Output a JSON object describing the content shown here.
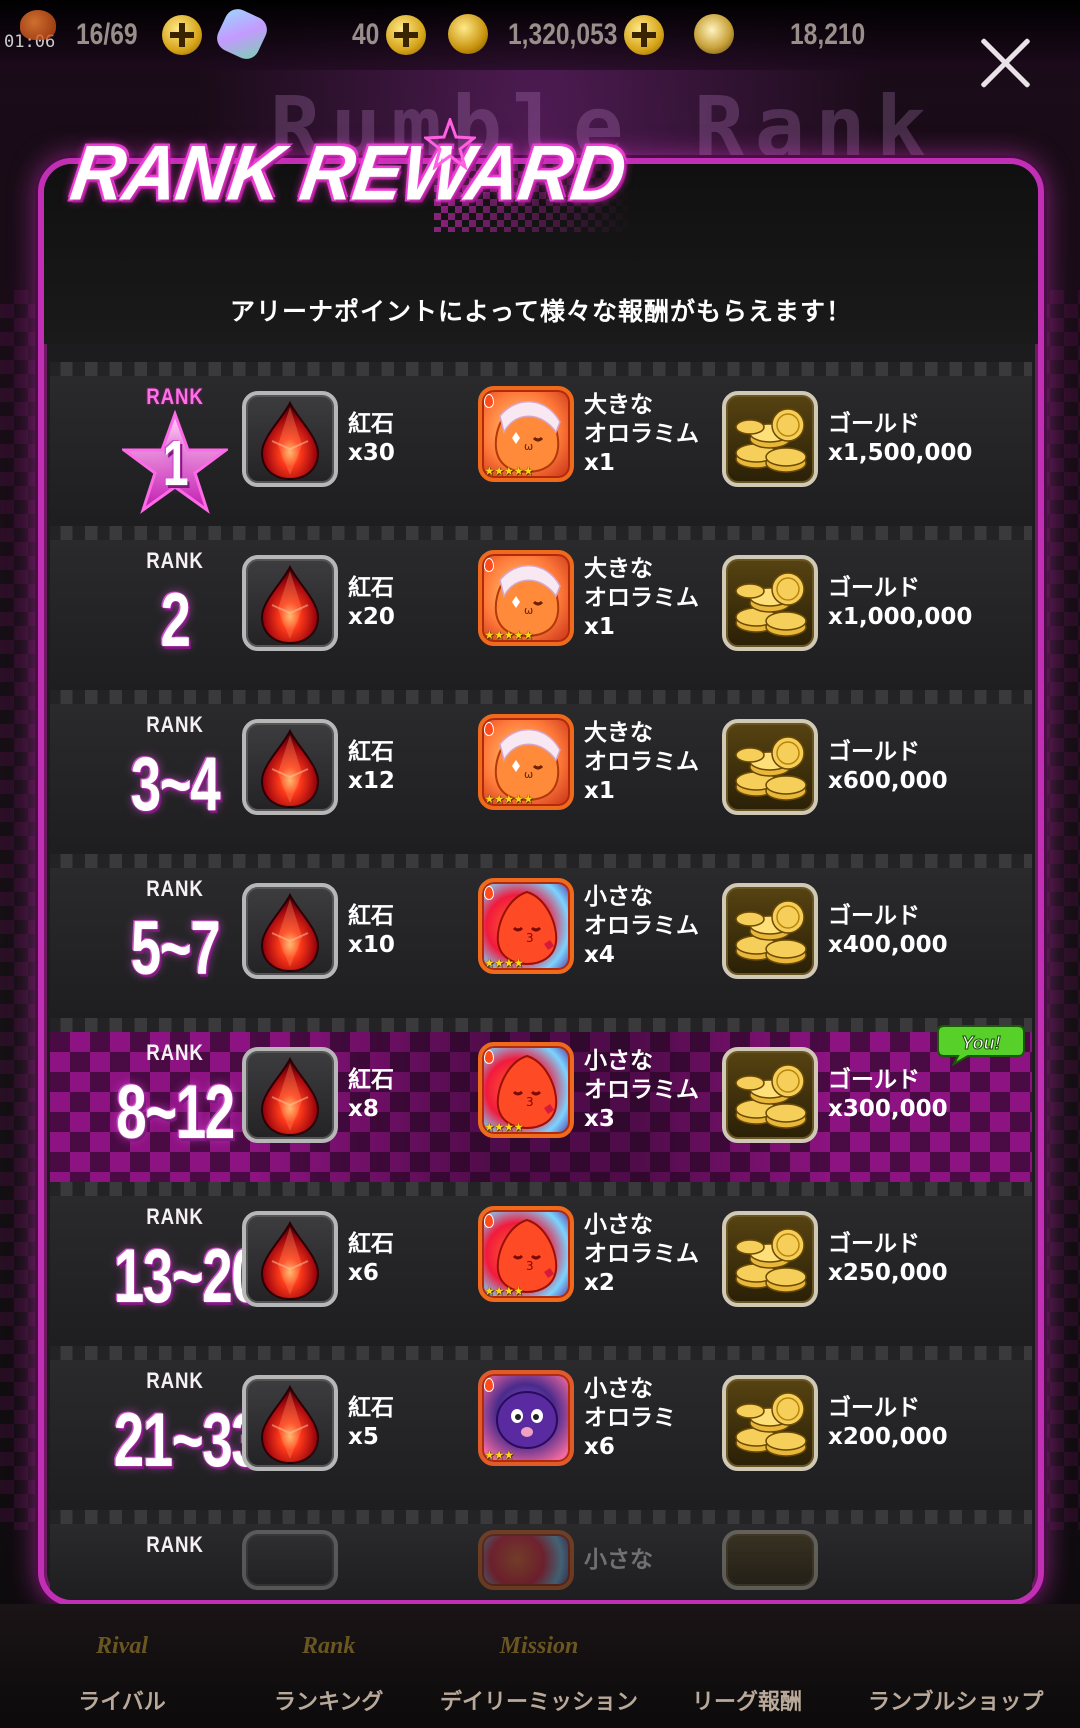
{
  "status_bar": {
    "time": "01:06",
    "stamina": "16/69",
    "crystals": "40",
    "gold": "1,320,053",
    "points": "18,210"
  },
  "background": {
    "heading": "Rumble Rank"
  },
  "modal": {
    "title": "RANK REWARD",
    "subtitle": "アリーナポイントによって様々な報酬がもらえます！"
  },
  "rank_word": "RANK",
  "you_badge": "You!",
  "rewards": [
    {
      "rank": "1",
      "gem": {
        "name": "紅石",
        "qty": "x30"
      },
      "monster": {
        "size": "大きな",
        "name": "オロラミム",
        "qty": "x1",
        "stars": "★★★★★"
      },
      "gold": {
        "name": "ゴールド",
        "qty": "x1,500,000"
      }
    },
    {
      "rank": "2",
      "gem": {
        "name": "紅石",
        "qty": "x20"
      },
      "monster": {
        "size": "大きな",
        "name": "オロラミム",
        "qty": "x1",
        "stars": "★★★★★"
      },
      "gold": {
        "name": "ゴールド",
        "qty": "x1,000,000"
      }
    },
    {
      "rank": "3~4",
      "gem": {
        "name": "紅石",
        "qty": "x12"
      },
      "monster": {
        "size": "大きな",
        "name": "オロラミム",
        "qty": "x1",
        "stars": "★★★★★"
      },
      "gold": {
        "name": "ゴールド",
        "qty": "x600,000"
      }
    },
    {
      "rank": "5~7",
      "gem": {
        "name": "紅石",
        "qty": "x10"
      },
      "monster": {
        "size": "小さな",
        "name": "オロラミム",
        "qty": "x4",
        "stars": "★★★★"
      },
      "gold": {
        "name": "ゴールド",
        "qty": "x400,000"
      }
    },
    {
      "rank": "8~12",
      "gem": {
        "name": "紅石",
        "qty": "x8"
      },
      "monster": {
        "size": "小さな",
        "name": "オロラミム",
        "qty": "x3",
        "stars": "★★★★"
      },
      "gold": {
        "name": "ゴールド",
        "qty": "x300,000"
      }
    },
    {
      "rank": "13~20",
      "gem": {
        "name": "紅石",
        "qty": "x6"
      },
      "monster": {
        "size": "小さな",
        "name": "オロラミム",
        "qty": "x2",
        "stars": "★★★★"
      },
      "gold": {
        "name": "ゴールド",
        "qty": "x250,000"
      }
    },
    {
      "rank": "21~33",
      "gem": {
        "name": "紅石",
        "qty": "x5"
      },
      "monster": {
        "size": "小さな",
        "name": "オロラミ",
        "qty": "x6",
        "stars": "★★★"
      },
      "gold": {
        "name": "ゴールド",
        "qty": "x200,000"
      }
    },
    {
      "rank": "",
      "monster": {
        "size": "小さな"
      }
    }
  ],
  "bottom_nav": [
    {
      "emblem": "Rival",
      "label": "ライバル"
    },
    {
      "emblem": "Rank",
      "label": "ランキング"
    },
    {
      "emblem": "Mission",
      "label": "デイリーミッション"
    },
    {
      "emblem": "",
      "label": "リーグ報酬"
    },
    {
      "emblem": "",
      "label": "ランブルショップ"
    }
  ],
  "colors": {
    "accent_pink": "#c12fb4",
    "panel_bg": "#1c1b1d",
    "gold": "#d6a51a"
  }
}
